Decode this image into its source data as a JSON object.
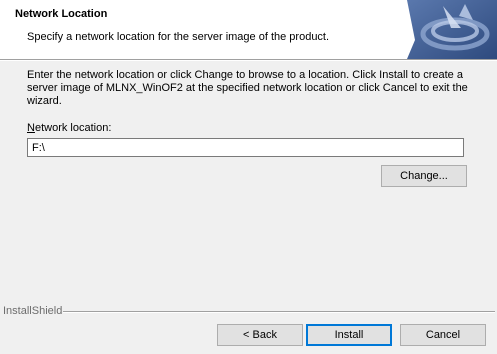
{
  "header": {
    "title": "Network Location",
    "subtitle": "Specify a network location for the server image of the product.",
    "graphic_icon": "installshield-graphic-icon"
  },
  "instructions": "Enter the network location or click Change to browse to a location.  Click Install to create a server image of MLNX_WinOF2 at the specified network location or click Cancel to exit the wizard.",
  "field": {
    "label_mnemonic": "N",
    "label_rest": "etwork location:",
    "value": "F:\\"
  },
  "buttons": {
    "change": "Change...",
    "back": "< Back",
    "install": "Install",
    "cancel": "Cancel"
  },
  "footer": {
    "brand": "InstallShield"
  },
  "colors": {
    "header_bg": "#ffffff",
    "dialog_bg": "#f0f0f0",
    "graphic_bg": "#3d5a8e",
    "default_button_border": "#0078d7"
  }
}
